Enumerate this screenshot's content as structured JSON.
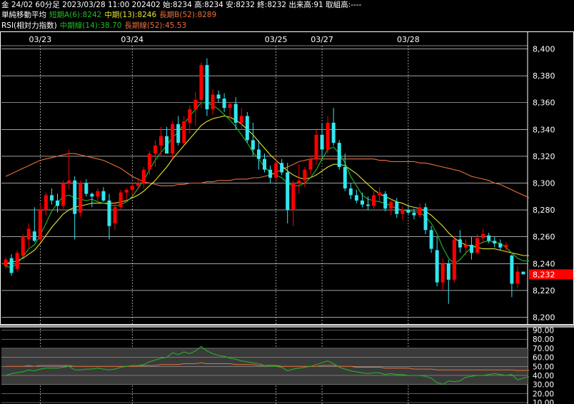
{
  "header": {
    "line1": "金 24/02 60分足 2023/03/28 11:00 202402 始:8234 高:8234 安:8232 終:8232 出来高:91 取組高:----",
    "line2_title": "単純移動平均",
    "ma_short": "短期A(6):8242",
    "ma_mid": "中期(13):8246",
    "ma_long": "長期B(52):8289",
    "line3_title": "RSI(相対力指数)",
    "rsi_mid": "中期線(14):38.70",
    "rsi_long": "長期線(52):45.53"
  },
  "colors": {
    "background": "#000000",
    "up_candle": "#ff0000",
    "down_candle": "#33e6ee",
    "ma_short": "#22bb22",
    "ma_mid": "#e6e633",
    "ma_long": "#e8703a",
    "rsi_mid": "#22bb22",
    "rsi_long": "#e8703a",
    "last_price_box": "#ff0000",
    "grid": "#ffffff"
  },
  "chart_data": [
    {
      "type": "candlestick",
      "panel": "price",
      "dates": [
        "03/23",
        "03/24",
        "03/25",
        "03/27",
        "03/28"
      ],
      "y_ticks": [
        "8,200",
        "8,220",
        "8,240",
        "8,260",
        "8,280",
        "8,300",
        "8,320",
        "8,340",
        "8,360",
        "8,380",
        "8,400"
      ],
      "ylim": [
        8196,
        8412
      ],
      "last_price_label": "8,232",
      "last_price": 8232,
      "candles": [
        [
          8238,
          8245,
          8236,
          8243
        ],
        [
          8244,
          8247,
          8231,
          8233
        ],
        [
          8236,
          8250,
          8234,
          8248
        ],
        [
          8246,
          8262,
          8245,
          8260
        ],
        [
          8258,
          8270,
          8252,
          8266
        ],
        [
          8264,
          8282,
          8256,
          8257
        ],
        [
          8258,
          8285,
          8256,
          8280
        ],
        [
          8280,
          8293,
          8276,
          8291
        ],
        [
          8291,
          8296,
          8284,
          8287
        ],
        [
          8287,
          8292,
          8278,
          8283
        ],
        [
          8283,
          8302,
          8281,
          8300
        ],
        [
          8300,
          8325,
          8295,
          8302
        ],
        [
          8302,
          8305,
          8258,
          8277
        ],
        [
          8278,
          8302,
          8275,
          8300
        ],
        [
          8300,
          8303,
          8290,
          8292
        ],
        [
          8292,
          8293,
          8282,
          8290
        ],
        [
          8290,
          8296,
          8285,
          8294
        ],
        [
          8294,
          8297,
          8286,
          8287
        ],
        [
          8287,
          8292,
          8258,
          8268
        ],
        [
          8270,
          8286,
          8265,
          8282
        ],
        [
          8282,
          8295,
          8280,
          8293
        ],
        [
          8293,
          8296,
          8287,
          8295
        ],
        [
          8295,
          8300,
          8291,
          8298
        ],
        [
          8298,
          8303,
          8295,
          8300
        ],
        [
          8300,
          8312,
          8296,
          8310
        ],
        [
          8310,
          8324,
          8306,
          8322
        ],
        [
          8322,
          8332,
          8312,
          8328
        ],
        [
          8328,
          8342,
          8320,
          8335
        ],
        [
          8335,
          8342,
          8325,
          8322
        ],
        [
          8322,
          8346,
          8318,
          8344
        ],
        [
          8344,
          8350,
          8328,
          8330
        ],
        [
          8330,
          8350,
          8328,
          8346
        ],
        [
          8345,
          8358,
          8337,
          8355
        ],
        [
          8355,
          8368,
          8343,
          8362
        ],
        [
          8362,
          8390,
          8356,
          8388
        ],
        [
          8388,
          8393,
          8350,
          8355
        ],
        [
          8355,
          8370,
          8351,
          8366
        ],
        [
          8366,
          8369,
          8360,
          8363
        ],
        [
          8363,
          8367,
          8353,
          8356
        ],
        [
          8356,
          8360,
          8348,
          8359
        ],
        [
          8359,
          8364,
          8340,
          8345
        ],
        [
          8345,
          8356,
          8340,
          8350
        ],
        [
          8350,
          8353,
          8330,
          8332
        ],
        [
          8332,
          8345,
          8320,
          8325
        ],
        [
          8325,
          8332,
          8310,
          8318
        ],
        [
          8318,
          8322,
          8308,
          8310
        ],
        [
          8310,
          8313,
          8300,
          8304
        ],
        [
          8304,
          8320,
          8302,
          8315
        ],
        [
          8315,
          8318,
          8306,
          8308
        ],
        [
          8308,
          8315,
          8270,
          8280
        ],
        [
          8280,
          8302,
          8268,
          8300
        ],
        [
          8300,
          8314,
          8292,
          8302
        ],
        [
          8302,
          8312,
          8297,
          8310
        ],
        [
          8310,
          8320,
          8306,
          8318
        ],
        [
          8318,
          8340,
          8314,
          8336
        ],
        [
          8336,
          8345,
          8320,
          8325
        ],
        [
          8325,
          8350,
          8322,
          8345
        ],
        [
          8345,
          8356,
          8328,
          8330
        ],
        [
          8330,
          8332,
          8310,
          8312
        ],
        [
          8312,
          8322,
          8294,
          8296
        ],
        [
          8296,
          8300,
          8288,
          8291
        ],
        [
          8291,
          8295,
          8285,
          8287
        ],
        [
          8287,
          8293,
          8282,
          8284
        ],
        [
          8284,
          8290,
          8280,
          8283
        ],
        [
          8283,
          8296,
          8281,
          8291
        ],
        [
          8291,
          8297,
          8286,
          8293
        ],
        [
          8292,
          8294,
          8279,
          8281
        ],
        [
          8281,
          8288,
          8276,
          8286
        ],
        [
          8286,
          8289,
          8274,
          8277
        ],
        [
          8277,
          8283,
          8273,
          8280
        ],
        [
          8280,
          8284,
          8276,
          8278
        ],
        [
          8278,
          8281,
          8273,
          8276
        ],
        [
          8276,
          8285,
          8274,
          8282
        ],
        [
          8282,
          8285,
          8262,
          8265
        ],
        [
          8265,
          8268,
          8248,
          8251
        ],
        [
          8250,
          8260,
          8223,
          8226
        ],
        [
          8226,
          8244,
          8220,
          8240
        ],
        [
          8240,
          8243,
          8210,
          8228
        ],
        [
          8228,
          8260,
          8226,
          8258
        ],
        [
          8258,
          8265,
          8248,
          8252
        ],
        [
          8252,
          8258,
          8246,
          8254
        ],
        [
          8254,
          8260,
          8243,
          8248
        ],
        [
          8248,
          8262,
          8247,
          8259
        ],
        [
          8259,
          8266,
          8255,
          8262
        ],
        [
          8261,
          8263,
          8255,
          8257
        ],
        [
          8257,
          8260,
          8252,
          8255
        ],
        [
          8255,
          8258,
          8250,
          8252
        ],
        [
          8252,
          8256,
          8248,
          8254
        ],
        [
          8246,
          8247,
          8215,
          8225
        ],
        [
          8225,
          8238,
          8222,
          8234
        ],
        [
          8234,
          8234,
          8232,
          8232
        ]
      ],
      "ma_short_values": [
        8238,
        8237,
        8240,
        8245,
        8251,
        8254,
        8261,
        8270,
        8279,
        8285,
        8290,
        8291,
        8289,
        8288,
        8287,
        8288,
        8286,
        8285,
        8284,
        8283,
        8284,
        8286,
        8290,
        8296,
        8302,
        8310,
        8317,
        8323,
        8328,
        8334,
        8338,
        8344,
        8350,
        8355,
        8360,
        8360,
        8358,
        8355,
        8351,
        8347,
        8342,
        8336,
        8330,
        8323,
        8318,
        8312,
        8308,
        8306,
        8304,
        8300,
        8298,
        8298,
        8300,
        8304,
        8310,
        8318,
        8325,
        8327,
        8322,
        8315,
        8305,
        8298,
        8291,
        8288,
        8287,
        8286,
        8285,
        8283,
        8281,
        8280,
        8279,
        8279,
        8278,
        8275,
        8270,
        8262,
        8252,
        8244,
        8240,
        8243,
        8248,
        8252,
        8254,
        8256,
        8257,
        8256,
        8255,
        8252,
        8248,
        8244,
        8242,
        8242
      ],
      "ma_mid_values": [
        8240,
        8241,
        8242,
        8244,
        8247,
        8250,
        8255,
        8261,
        8267,
        8272,
        8277,
        8280,
        8282,
        8283,
        8284,
        8285,
        8285,
        8285,
        8285,
        8285,
        8286,
        8287,
        8289,
        8291,
        8294,
        8298,
        8302,
        8307,
        8312,
        8318,
        8323,
        8328,
        8333,
        8338,
        8343,
        8346,
        8348,
        8349,
        8350,
        8349,
        8347,
        8344,
        8340,
        8336,
        8331,
        8326,
        8321,
        8317,
        8313,
        8309,
        8306,
        8304,
        8303,
        8304,
        8306,
        8309,
        8312,
        8314,
        8314,
        8313,
        8310,
        8307,
        8303,
        8299,
        8295,
        8292,
        8290,
        8288,
        8286,
        8285,
        8283,
        8282,
        8281,
        8279,
        8276,
        8272,
        8268,
        8263,
        8259,
        8256,
        8254,
        8253,
        8252,
        8251,
        8251,
        8251,
        8250,
        8249,
        8248,
        8247,
        8246,
        8246
      ],
      "ma_long_values": [
        8305,
        8307,
        8309,
        8311,
        8313,
        8315,
        8317,
        8318,
        8319,
        8320,
        8321,
        8322,
        8322,
        8321,
        8320,
        8319,
        8318,
        8317,
        8315,
        8313,
        8311,
        8308,
        8305,
        8303,
        8301,
        8300,
        8299,
        8298,
        8298,
        8298,
        8299,
        8299,
        8300,
        8300,
        8300,
        8301,
        8301,
        8302,
        8302,
        8302,
        8303,
        8303,
        8303,
        8304,
        8304,
        8305,
        8306,
        8308,
        8310,
        8312,
        8314,
        8316,
        8317,
        8318,
        8318,
        8318,
        8318,
        8318,
        8318,
        8318,
        8318,
        8318,
        8318,
        8318,
        8318,
        8317,
        8317,
        8316,
        8316,
        8316,
        8316,
        8316,
        8315,
        8315,
        8314,
        8313,
        8312,
        8311,
        8310,
        8309,
        8307,
        8305,
        8304,
        8303,
        8302,
        8300,
        8299,
        8297,
        8295,
        8293,
        8291,
        8289
      ]
    },
    {
      "type": "line",
      "panel": "rsi",
      "y_ticks": [
        "10.00",
        "20.00",
        "30.00",
        "40.00",
        "50.00",
        "60.00",
        "70.00",
        "80.00",
        "90.00"
      ],
      "ylim": [
        10,
        92
      ],
      "shaded_band": [
        30,
        70
      ],
      "series": [
        {
          "name": "中期線(14)",
          "values": [
            40,
            42,
            43,
            44,
            46,
            45,
            47,
            48,
            48,
            48,
            49,
            50,
            46,
            46,
            47,
            47,
            48,
            47,
            46,
            47,
            49,
            50,
            51,
            51,
            52,
            55,
            57,
            59,
            60,
            65,
            63,
            66,
            64,
            67,
            72,
            67,
            64,
            62,
            61,
            59,
            58,
            56,
            55,
            54,
            53,
            51,
            50,
            50,
            49,
            45,
            47,
            48,
            49,
            50,
            52,
            54,
            56,
            53,
            49,
            47,
            45,
            44,
            43,
            42,
            43,
            43,
            41,
            42,
            41,
            41,
            40,
            40,
            40,
            39,
            37,
            32,
            30,
            34,
            33,
            34,
            38,
            39,
            40,
            40,
            41,
            42,
            41,
            40,
            41,
            35,
            37,
            38.7
          ]
        },
        {
          "name": "長期線(52)",
          "values": [
            50,
            50,
            50,
            50,
            51,
            50,
            51,
            51,
            51,
            51,
            51,
            51,
            50,
            50,
            50,
            50,
            50,
            50,
            50,
            50,
            50,
            50,
            50,
            50,
            51,
            51,
            51,
            52,
            52,
            52,
            52,
            53,
            53,
            53,
            54,
            53,
            53,
            53,
            53,
            53,
            52,
            52,
            52,
            52,
            51,
            51,
            51,
            51,
            50,
            50,
            50,
            50,
            50,
            50,
            50,
            51,
            51,
            51,
            50,
            50,
            50,
            49,
            49,
            49,
            49,
            49,
            48,
            48,
            48,
            48,
            48,
            47,
            47,
            47,
            47,
            46,
            46,
            46,
            46,
            46,
            46,
            46,
            46,
            46,
            46,
            46,
            46,
            46,
            46,
            45.5,
            45.5,
            45.53
          ]
        }
      ]
    }
  ]
}
